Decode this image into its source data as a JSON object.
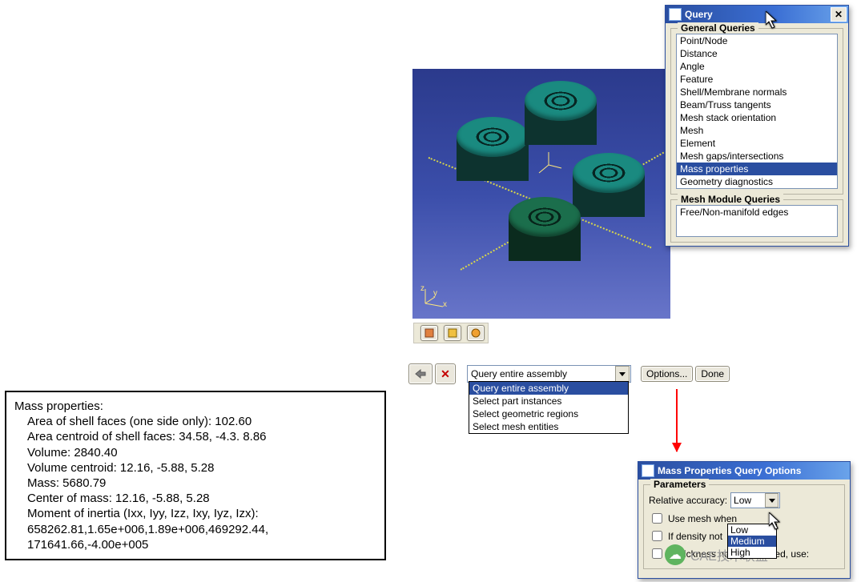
{
  "mass_properties": {
    "title": "Mass properties:",
    "lines": {
      "area": "Area of shell faces (one side only): 102.60",
      "area_centroid": "Area centroid of shell faces: 34.58, -4.3. 8.86",
      "volume": "Volume: 2840.40",
      "volume_centroid": "Volume centroid: 12.16, -5.88, 5.28",
      "mass": "Mass: 5680.79",
      "center_of_mass": "Center of mass: 12.16, -5.88, 5.28",
      "moi_label": "Moment of inertia (Ixx, Iyy, Izz, Ixy, Iyz, Izx):",
      "moi_vals1": "658262.81,1.65e+006,1.89e+006,469292.44,",
      "moi_vals2": "171641.66,-4.00e+005"
    }
  },
  "viewport": {
    "axes": {
      "x": "x",
      "y": "y",
      "z": "z"
    }
  },
  "query_toolbar": {
    "combo_value": "Query entire assembly",
    "dropdown": {
      "opt0": "Query entire assembly",
      "opt1": "Select part instances",
      "opt2": "Select geometric regions",
      "opt3": "Select mesh entities"
    },
    "options": "Options...",
    "done": "Done"
  },
  "query_dialog": {
    "title": "Query",
    "group1": "General Queries",
    "items": {
      "i0": "Point/Node",
      "i1": "Distance",
      "i2": "Angle",
      "i3": "Feature",
      "i4": "Shell/Membrane normals",
      "i5": "Beam/Truss tangents",
      "i6": "Mesh stack orientation",
      "i7": "Mesh",
      "i8": "Element",
      "i9": "Mesh gaps/intersections",
      "i10": "Mass properties",
      "i11": "Geometry diagnostics"
    },
    "group2": "Mesh Module Queries",
    "mesh_item": "Free/Non-manifold edges"
  },
  "mpq_dialog": {
    "title": "Mass Properties Query Options",
    "group": "Parameters",
    "rel_accuracy_label": "Relative accuracy:",
    "rel_accuracy_value": "Low",
    "dd": {
      "o0": "Low",
      "o1": "Medium",
      "o2": "High"
    },
    "use_mesh": "Use mesh when",
    "if_density": "If density not",
    "if_thickness": "If thickness not well defined, use:"
  },
  "watermark": "CAE技术联盟"
}
